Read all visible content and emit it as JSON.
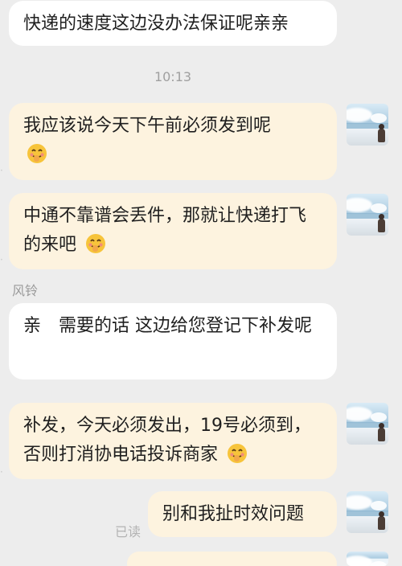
{
  "chat": {
    "messages": [
      {
        "text": "快递的速度这边没办法保证呢亲亲",
        "emoji": ""
      },
      {
        "text": "我应该说今天下午前必须发到呢",
        "emoji": "shy-smile-emoji"
      },
      {
        "text": "中通不靠谱会丢件，那就让快递打飞的来吧",
        "emoji": "shy-smile-emoji"
      },
      {
        "text": "亲　需要的话  这边给您登记下补发呢",
        "emoji": ""
      },
      {
        "text": "补发，今天必须发出，19号必须到，否则打消协电话投诉商家",
        "emoji": "shy-smile-emoji"
      },
      {
        "text": "别和我扯时效问题",
        "emoji": ""
      }
    ],
    "timestamp": "10:13",
    "sender_name": "风铃",
    "read_receipt": "已读"
  },
  "colors": {
    "page_background": "#ededed",
    "incoming_bubble": "#ffffff",
    "outgoing_bubble": "#fdf3df",
    "text": "#1f1f1f",
    "meta_text": "#a0a0a0"
  }
}
